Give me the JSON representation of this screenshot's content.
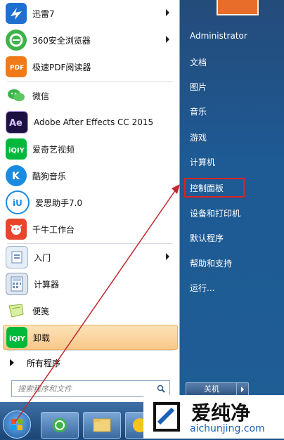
{
  "programs": [
    {
      "label": "迅雷7",
      "has_arrow": true,
      "icon": "thunder-icon"
    },
    {
      "label": "360安全浏览器",
      "has_arrow": true,
      "icon": "360-browser-icon"
    },
    {
      "label": "极速PDF阅读器",
      "has_arrow": false,
      "icon": "pdf-reader-icon"
    },
    {
      "label": "微信",
      "has_arrow": false,
      "icon": "wechat-icon"
    },
    {
      "label": "Adobe After Effects CC 2015",
      "has_arrow": false,
      "icon": "after-effects-icon"
    },
    {
      "label": "爱奇艺视频",
      "has_arrow": false,
      "icon": "iqiyi-icon"
    },
    {
      "label": "酷狗音乐",
      "has_arrow": false,
      "icon": "kugou-icon"
    },
    {
      "label": "爱思助手7.0",
      "has_arrow": false,
      "icon": "i4-assistant-icon"
    },
    {
      "label": "千牛工作台",
      "has_arrow": false,
      "icon": "qianniu-icon"
    },
    {
      "label": "入门",
      "has_arrow": true,
      "icon": "getting-started-icon"
    },
    {
      "label": "计算器",
      "has_arrow": false,
      "icon": "calculator-icon"
    },
    {
      "label": "便笺",
      "has_arrow": false,
      "icon": "sticky-notes-icon"
    },
    {
      "label": "卸载",
      "has_arrow": false,
      "icon": "iqiyi-uninstall-icon"
    }
  ],
  "all_programs_label": "所有程序",
  "search_placeholder": "搜索程序和文件",
  "right_items": [
    "Administrator",
    "文档",
    "图片",
    "音乐",
    "游戏",
    "计算机",
    "控制面板",
    "设备和打印机",
    "默认程序",
    "帮助和支持",
    "运行..."
  ],
  "shutdown_label": "关机",
  "watermark": {
    "title": "爱纯净",
    "url": "aichunjing.com"
  },
  "colors": {
    "highlight_box": "#e02020",
    "annotation_arrow": "#c0282d",
    "link_blue": "#1a5fb8"
  }
}
